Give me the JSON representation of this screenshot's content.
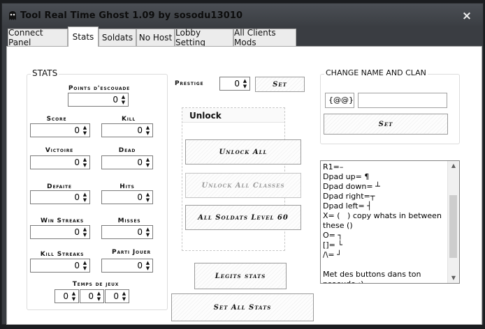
{
  "window": {
    "title": "Tool Real Time Ghost 1.09 by sosodu13010",
    "close_glyph": "×"
  },
  "tabs": [
    {
      "label": "Connect Panel",
      "active": false
    },
    {
      "label": "Stats",
      "active": true
    },
    {
      "label": "Soldats",
      "active": false
    },
    {
      "label": "No Host",
      "active": false
    },
    {
      "label": "Lobby Setting",
      "active": false
    },
    {
      "label": "All Clients Mods",
      "active": false
    }
  ],
  "stats": {
    "group_title": "STATS",
    "points_escouade": {
      "label": "Points d'escouade",
      "value": "0"
    },
    "score": {
      "label": "Score",
      "value": "0"
    },
    "kill": {
      "label": "Kill",
      "value": "0"
    },
    "victoire": {
      "label": "Victoire",
      "value": "0"
    },
    "dead": {
      "label": "Dead",
      "value": "0"
    },
    "defaite": {
      "label": "Defaite",
      "value": "0"
    },
    "hits": {
      "label": "Hits",
      "value": "0"
    },
    "win_streaks": {
      "label": "Win Streaks",
      "value": "0"
    },
    "misses": {
      "label": "Misses",
      "value": "0"
    },
    "kill_streaks": {
      "label": "Kill Streaks",
      "value": "0"
    },
    "parti_jouer": {
      "label": "Parti Jouer",
      "value": "0"
    },
    "temps_de_jeux": {
      "label": "Temps de jeux",
      "values": [
        "0",
        "0",
        "0"
      ]
    }
  },
  "prestige": {
    "label": "Prestige",
    "value": "0",
    "set_label": "Set"
  },
  "unlock": {
    "title": "Unlock",
    "unlock_all": "Unlock All",
    "unlock_all_classes": "Unlock All Classes",
    "all_soldats_level_60": "All Soldats Level 60"
  },
  "legits_stats": "Legits stats",
  "set_all_stats": "Set All Stats",
  "change_name": {
    "title": "CHANGE NAME AND CLAN",
    "clan_value": "{@@}",
    "name_value": "",
    "set_label": "Set"
  },
  "notes": {
    "text": "R1=–\nDpad up= ¶\nDpad down= ┴\nDpad right=┬\nDpad left= ┤\nX= (   ) copy whats in between these ()\nO= ┐\n[]= └\n/\\= ┘\n\nMet des buttons dans ton psoeudo :)"
  },
  "colors": {
    "chrome": "#3a3d42",
    "client": "#ffffff",
    "border": "#a9a9a9"
  },
  "icons": {
    "app": "ghost-icon",
    "close": "close-icon",
    "up": "arrow-up-icon",
    "down": "arrow-down-icon"
  }
}
